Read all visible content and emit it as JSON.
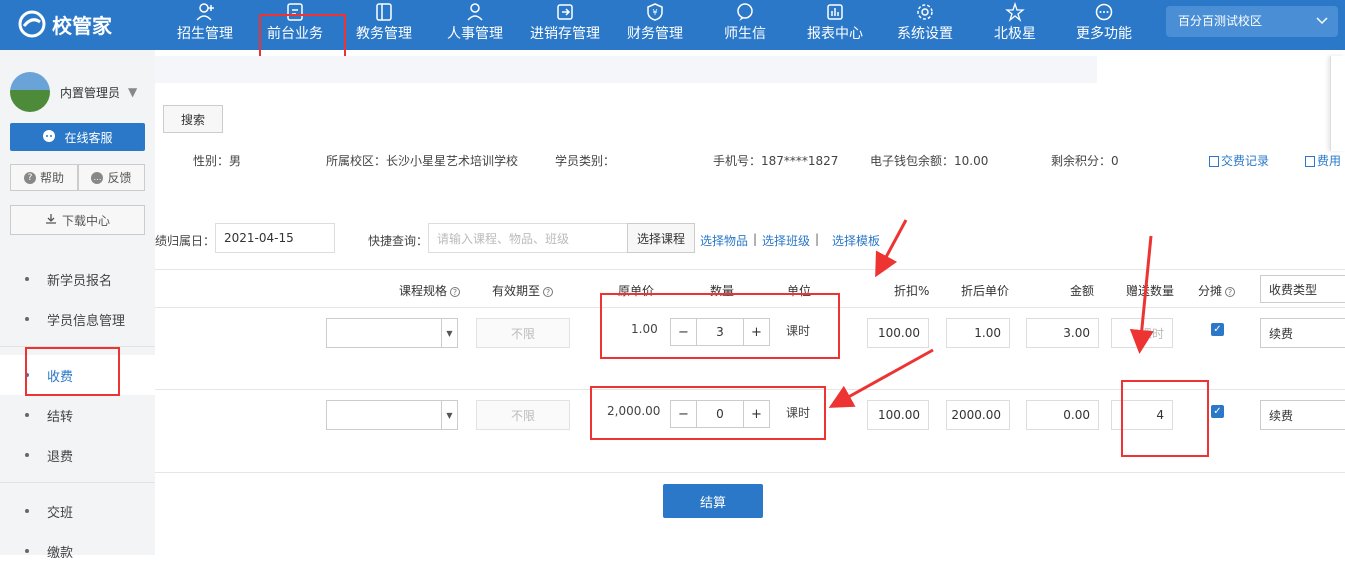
{
  "topbar": {
    "logo": "校管家",
    "nav": [
      {
        "label": "招生管理",
        "icon": "person-plus-icon"
      },
      {
        "label": "前台业务",
        "icon": "document-edit-icon"
      },
      {
        "label": "教务管理",
        "icon": "book-icon"
      },
      {
        "label": "人事管理",
        "icon": "person-icon"
      },
      {
        "label": "进销存管理",
        "icon": "exchange-icon"
      },
      {
        "label": "财务管理",
        "icon": "yen-shield-icon"
      },
      {
        "label": "师生信",
        "icon": "chat-bubble-icon"
      },
      {
        "label": "报表中心",
        "icon": "bar-chart-icon"
      },
      {
        "label": "系统设置",
        "icon": "gear-icon"
      },
      {
        "label": "北极星",
        "icon": "star-icon"
      },
      {
        "label": "更多功能",
        "icon": "more-circle-icon"
      }
    ],
    "campus": "百分百测试校区",
    "accent": "#2b78c8"
  },
  "sidebar": {
    "user": "内置管理员",
    "online_service": "在线客服",
    "help": "帮助",
    "feedback": "反馈",
    "download": "下载中心",
    "items": [
      "新学员报名",
      "学员信息管理",
      "收费",
      "结转",
      "退费",
      "交班",
      "缴款"
    ],
    "active": "收费"
  },
  "main": {
    "search_btn": "搜索",
    "student": {
      "gender": "性别：男",
      "campus": "所属校区：长沙小星星艺术培训学校",
      "category": "学员类别：",
      "phone": "手机号：187****1827",
      "wallet": "电子钱包余额：10.00",
      "points": "剩余积分：0",
      "fee_record": "交费记录",
      "fee_link": "费用"
    },
    "date_label": "绩归属日：",
    "date_value": "2021-04-15",
    "quick_label": "快捷查询：",
    "quick_placeholder": "请输入课程、物品、班级",
    "choose_course": "选择课程",
    "choose_item": "选择物品",
    "choose_class": "选择班级",
    "choose_template": "选择模板",
    "headers": {
      "spec": "课程规格",
      "valid": "有效期至",
      "price": "原单价",
      "qty": "数量",
      "unit": "单位",
      "discount": "折扣%",
      "after": "折后单价",
      "amount": "金额",
      "gift": "赠送数量",
      "split": "分摊",
      "fee_type": "收费类型"
    },
    "rows": [
      {
        "valid": "不限",
        "price": "1.00",
        "qty": "3",
        "unit": "课时",
        "discount": "100.00",
        "after": "1.00",
        "amount": "3.00",
        "gift": "课时",
        "fee_type": "续费",
        "split_checked": true
      },
      {
        "valid": "不限",
        "price": "2,000.00",
        "qty": "0",
        "unit": "课时",
        "discount": "100.00",
        "after": "2000.00",
        "amount": "0.00",
        "gift": "4",
        "fee_type": "续费",
        "split_checked": true
      }
    ],
    "settle": "结算"
  }
}
